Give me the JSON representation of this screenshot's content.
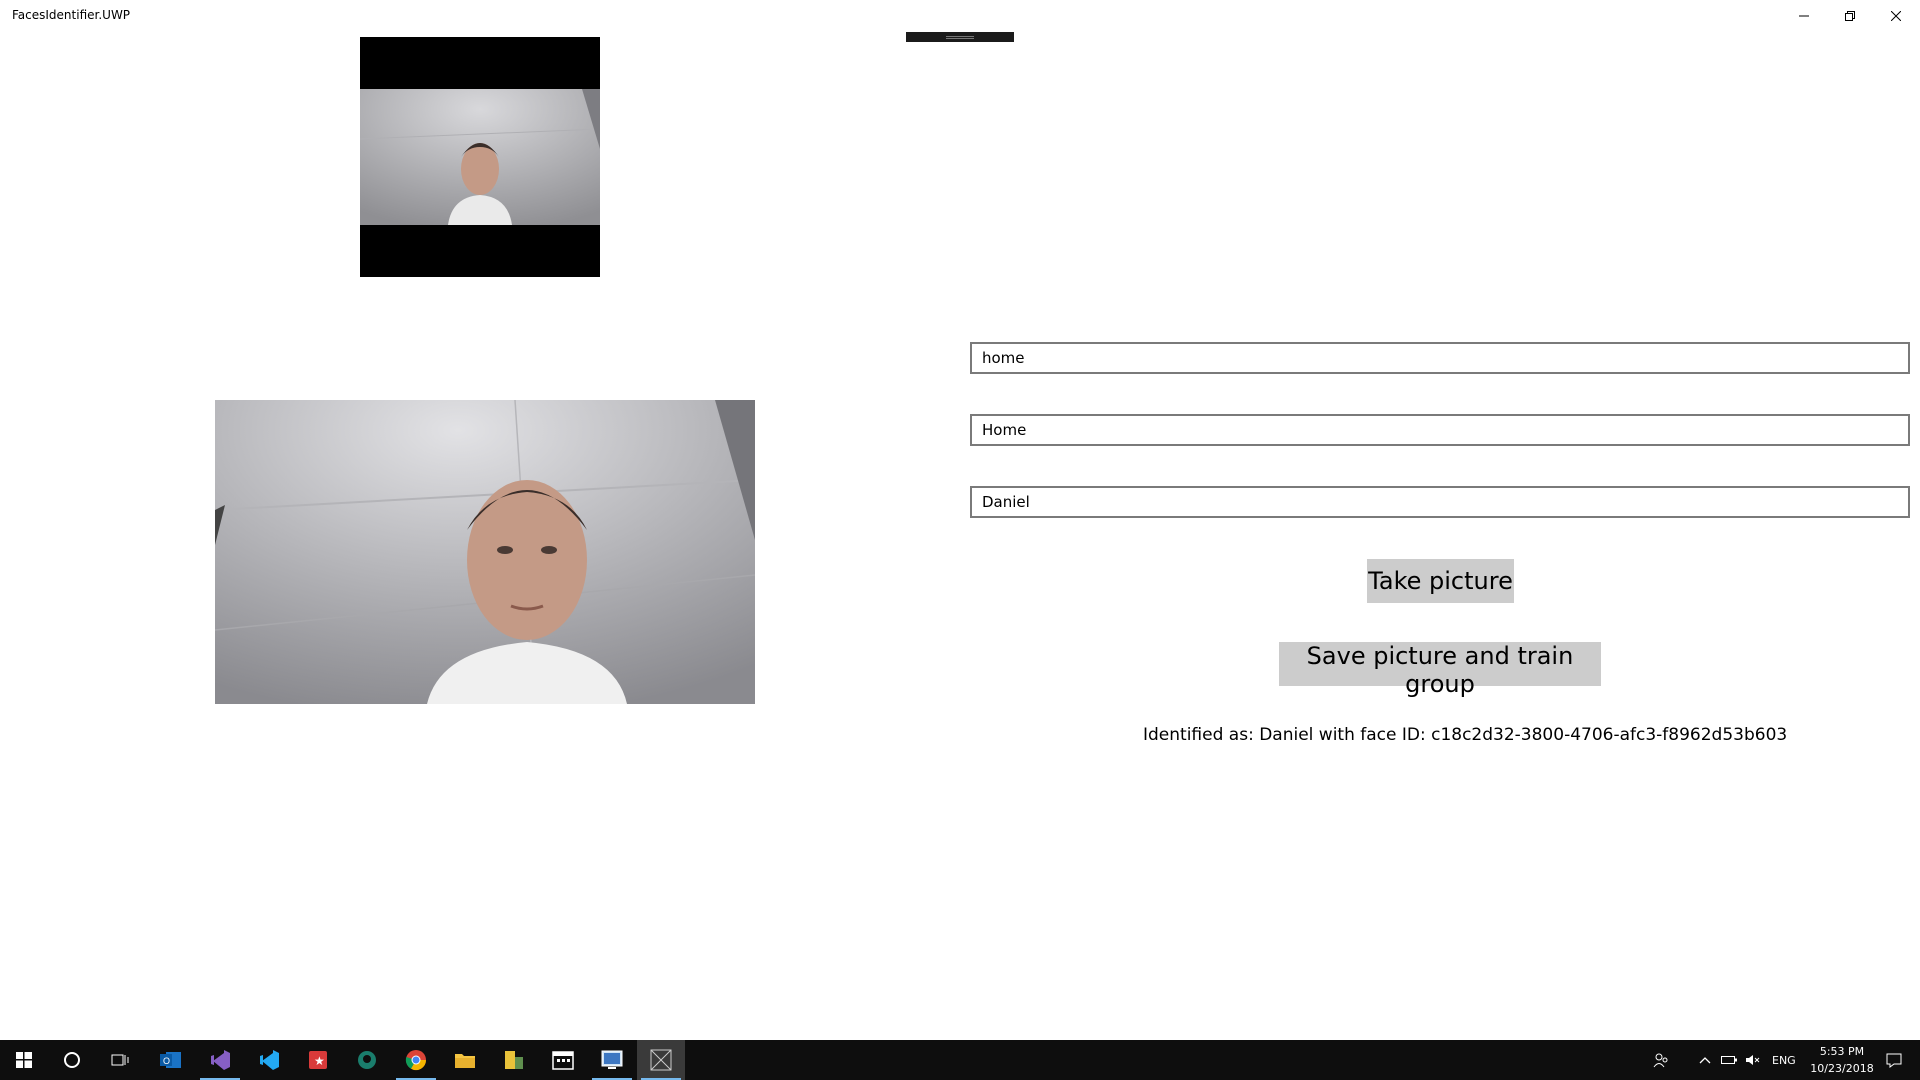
{
  "window": {
    "title": "FacesIdentifier.UWP"
  },
  "form": {
    "group_id": {
      "value": "home"
    },
    "group_name": {
      "value": "Home"
    },
    "person_name": {
      "value": "Daniel"
    }
  },
  "buttons": {
    "take_picture": "Take picture",
    "save_and_train": "Save picture and train group"
  },
  "result": {
    "text": "Identified as: Daniel with face ID: c18c2d32-3800-4706-afc3-f8962d53b603"
  },
  "taskbar": {
    "icons": [
      "start-icon",
      "cortana-icon",
      "task-view-icon",
      "outlook-icon",
      "visual-studio-icon",
      "vscode-icon",
      "red-app-icon",
      "gitkraken-icon",
      "chrome-icon",
      "file-explorer-icon",
      "tool-icon",
      "calendar-app-icon",
      "remote-app-icon",
      "uwp-app-icon"
    ],
    "tray": {
      "language": "ENG",
      "time": "5:53 PM",
      "date": "10/23/2018"
    }
  },
  "colors": {
    "taskbar_bg": "#0e0e0e",
    "button_bg": "#cccccc",
    "input_border": "#7a7a7a",
    "accent": "#76b9ed"
  }
}
